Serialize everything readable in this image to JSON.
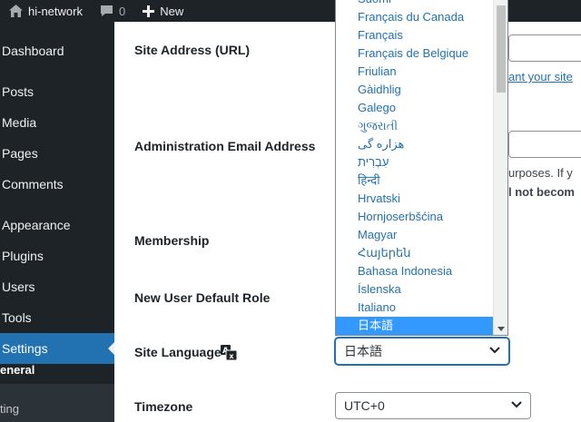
{
  "adminbar": {
    "site_name": "hi-network",
    "comments_count": "0",
    "new_label": "New"
  },
  "sidebar": {
    "items": [
      {
        "label": "Dashboard"
      },
      {
        "label": "Posts"
      },
      {
        "label": "Media"
      },
      {
        "label": "Pages"
      },
      {
        "label": "Comments"
      },
      {
        "label": "Appearance"
      },
      {
        "label": "Plugins"
      },
      {
        "label": "Users"
      },
      {
        "label": "Tools"
      },
      {
        "label": "Settings"
      }
    ],
    "submenu": [
      {
        "label": "eneral"
      },
      {
        "label": "ting"
      }
    ]
  },
  "form": {
    "site_address_label": "Site Address (URL)",
    "site_address_help_link": "ant your site",
    "admin_email_label": "Administration Email Address",
    "admin_email_help1": "urposes. If y",
    "admin_email_help2": "l not becom",
    "membership_label": "Membership",
    "default_role_label": "New User Default Role",
    "site_language_label": "Site Language",
    "site_language_value": "日本語",
    "timezone_label": "Timezone",
    "timezone_value": "UTC+0"
  },
  "language_options": [
    "Suomi",
    "Français du Canada",
    "Français",
    "Français de Belgique",
    "Friulian",
    "Gàidhlig",
    "Galego",
    "ગુજરાતી",
    "هزاره گی",
    "עִבְרִית",
    "हिन्दी",
    "Hrvatski",
    "Hornjoserbšćina",
    "Magyar",
    "Հայերեն",
    "Bahasa Indonesia",
    "Íslenska",
    "Italiano",
    "日本語"
  ],
  "selected_language_index": 18,
  "icons": {
    "home": "home-icon",
    "comments": "comment-bubble-icon",
    "new": "plus-icon",
    "translation": "translation-icon",
    "chevron": "chevron-down-icon"
  },
  "colors": {
    "adminbar_bg": "#1d2327",
    "accent": "#2271b1",
    "selected_option_bg": "#3399ff"
  }
}
